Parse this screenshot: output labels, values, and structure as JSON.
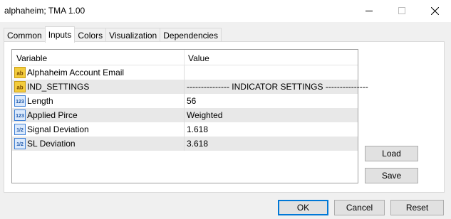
{
  "window": {
    "title": "alphaheim; TMA 1.00"
  },
  "tabs": [
    {
      "label": "Common"
    },
    {
      "label": "Inputs"
    },
    {
      "label": "Colors"
    },
    {
      "label": "Visualization"
    },
    {
      "label": "Dependencies"
    }
  ],
  "grid": {
    "headers": {
      "variable": "Variable",
      "value": "Value"
    },
    "rows": [
      {
        "icon": "ab",
        "variable": "Alphaheim Account Email",
        "value": ""
      },
      {
        "icon": "ab",
        "variable": "IND_SETTINGS",
        "value": "--------------- INDICATOR SETTINGS ---------------"
      },
      {
        "icon": "123",
        "variable": "Length",
        "value": "56"
      },
      {
        "icon": "123",
        "variable": "Applied Pirce",
        "value": "Weighted"
      },
      {
        "icon": "1/2",
        "variable": "Signal Deviation",
        "value": "1.618"
      },
      {
        "icon": "1/2",
        "variable": "SL Deviation",
        "value": "3.618"
      }
    ]
  },
  "side_buttons": {
    "load": "Load",
    "save": "Save"
  },
  "footer_buttons": {
    "ok": "OK",
    "cancel": "Cancel",
    "reset": "Reset"
  },
  "colors": {
    "accent": "#0078d7",
    "row_alt": "#e8e8e8"
  }
}
